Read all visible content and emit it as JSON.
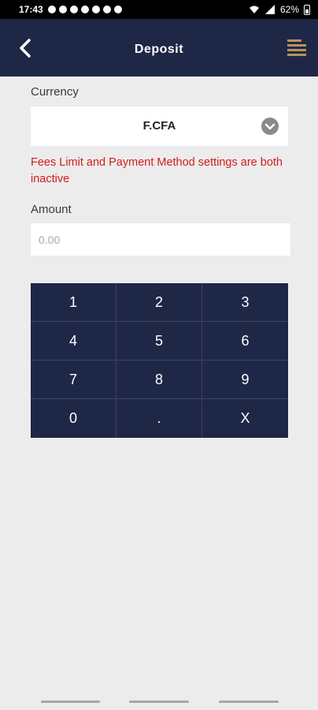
{
  "status_bar": {
    "time": "17:43",
    "battery": "62%"
  },
  "app_bar": {
    "title": "Deposit",
    "icons": {
      "back": "chevron-left-icon",
      "menu": "hamburger-menu-icon"
    },
    "colors": {
      "background": "#1f2747",
      "menu_accent": "#b8935a"
    }
  },
  "form": {
    "currency_label": "Currency",
    "currency_value": "F.CFA",
    "error_message": "Fees Limit and Payment Method settings are both inactive",
    "amount_label": "Amount",
    "amount_placeholder": "0.00",
    "colors": {
      "error": "#d31c1c"
    }
  },
  "keypad": {
    "keys": [
      [
        "1",
        "2",
        "3"
      ],
      [
        "4",
        "5",
        "6"
      ],
      [
        "7",
        "8",
        "9"
      ],
      [
        "0",
        ".",
        "X"
      ]
    ]
  }
}
